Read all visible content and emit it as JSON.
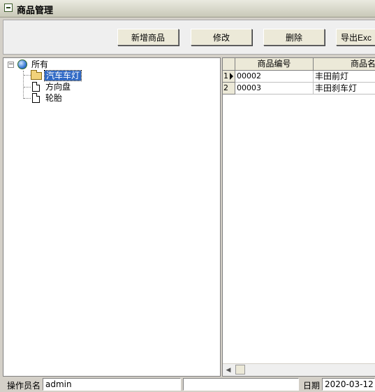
{
  "window": {
    "title": "商品管理"
  },
  "toolbar": {
    "add_label": "新增商品",
    "edit_label": "修改",
    "delete_label": "删除",
    "export_label": "导出Exc"
  },
  "tree": {
    "root": {
      "label": "所有",
      "expander": "−"
    },
    "children": [
      {
        "label": "汽车车灯",
        "selected": true
      },
      {
        "label": "方向盘"
      },
      {
        "label": "轮胎"
      }
    ]
  },
  "grid": {
    "columns": [
      "商品编号",
      "商品名"
    ],
    "rows": [
      {
        "index": "1",
        "code": "00002",
        "name": "丰田前灯"
      },
      {
        "index": "2",
        "code": "00003",
        "name": "丰田刹车灯"
      }
    ]
  },
  "status": {
    "operator_label": "操作员名",
    "operator_value": "admin",
    "date_label": "日期",
    "date_value": "2020-03-12"
  },
  "colors": {
    "selection": "#316ac5",
    "chrome": "#d4d0c8"
  }
}
